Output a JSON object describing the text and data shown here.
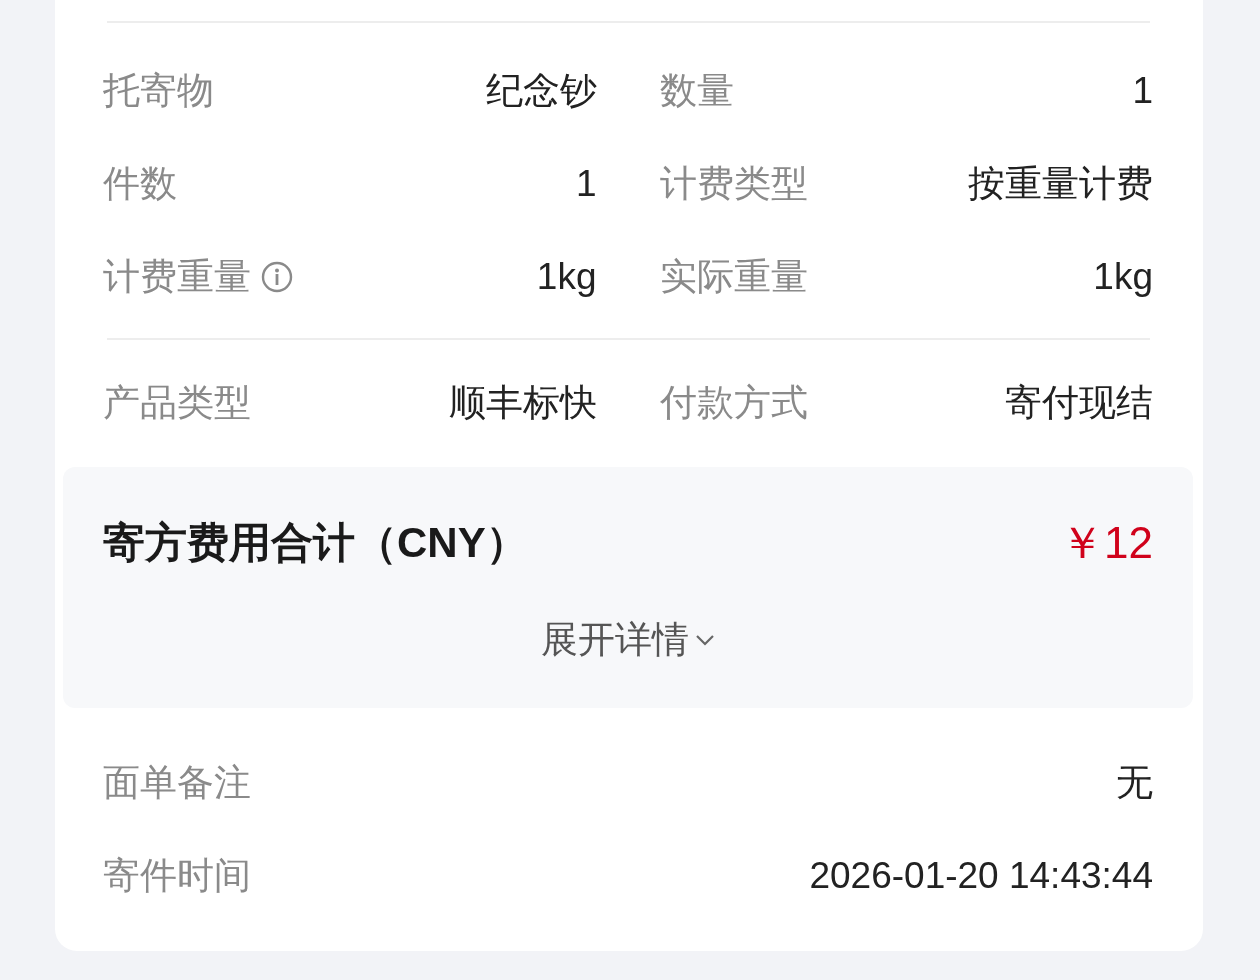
{
  "shipment_details": [
    {
      "label": "托寄物",
      "value": "纪念钞",
      "info": false
    },
    {
      "label": "数量",
      "value": "1",
      "info": false
    },
    {
      "label": "件数",
      "value": "1",
      "info": false
    },
    {
      "label": "计费类型",
      "value": "按重量计费",
      "info": false
    },
    {
      "label": "计费重量",
      "value": "1kg",
      "info": true
    },
    {
      "label": "实际重量",
      "value": "1kg",
      "info": false
    }
  ],
  "service_details": [
    {
      "label": "产品类型",
      "value": "顺丰标快"
    },
    {
      "label": "付款方式",
      "value": "寄付现结"
    }
  ],
  "fee_summary": {
    "title": "寄方费用合计（CNY）",
    "amount": "￥12",
    "toggle": {
      "label": "展开详情",
      "expanded": false
    }
  },
  "remarks": [
    {
      "label": "面单备注",
      "value": "无"
    },
    {
      "label": "寄件时间",
      "value": "2026-01-20 14:43:44"
    }
  ]
}
